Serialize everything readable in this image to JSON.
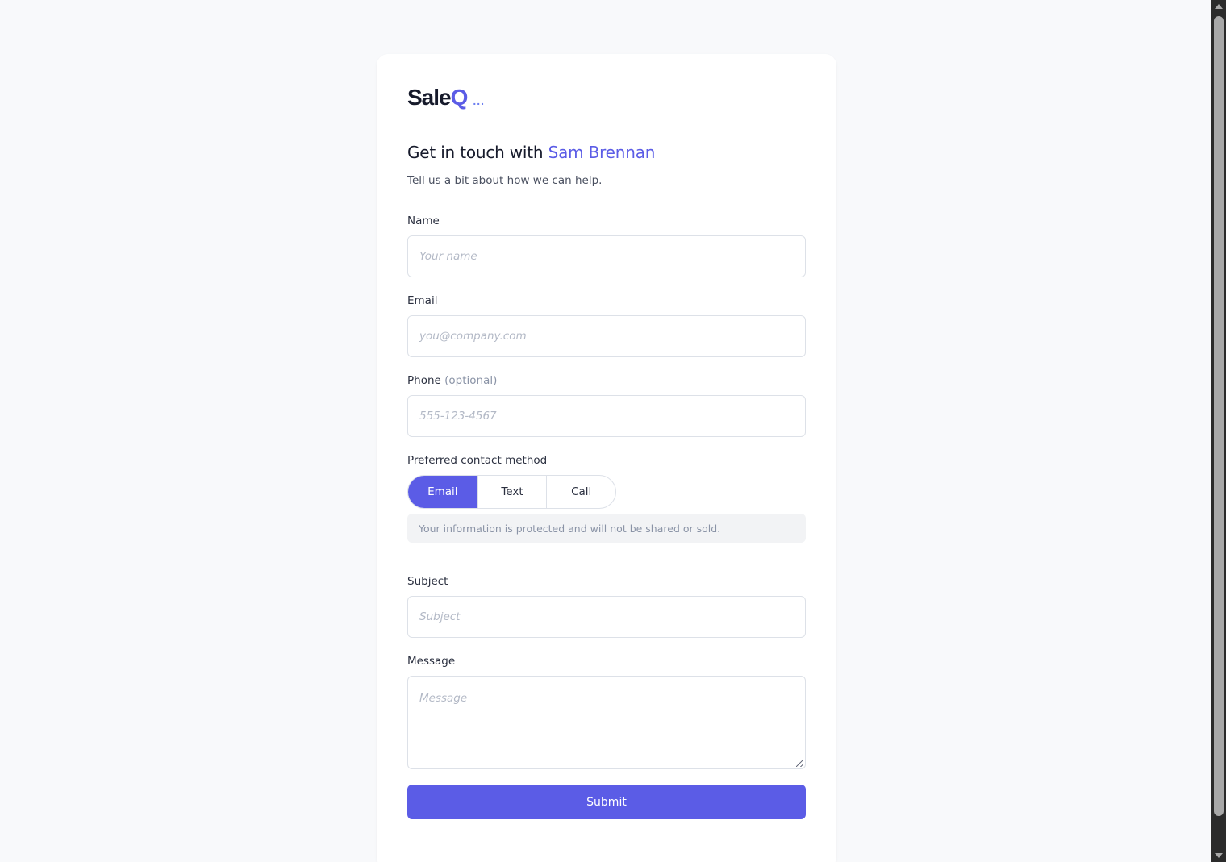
{
  "logo": {
    "main": "Sale",
    "accent": "Q",
    "dots": "..."
  },
  "heading": {
    "prefix": "Get in touch with ",
    "name": "Sam Brennan"
  },
  "subtitle": "Tell us a bit about how we can help.",
  "form": {
    "name": {
      "label": "Name",
      "placeholder": "Your name",
      "value": ""
    },
    "email": {
      "label": "Email",
      "placeholder": "you@company.com",
      "value": ""
    },
    "phone": {
      "label": "Phone",
      "optional": "(optional)",
      "placeholder": "555-123-4567",
      "value": ""
    },
    "contact_method": {
      "label": "Preferred contact method",
      "options": [
        "Email",
        "Text",
        "Call"
      ],
      "selected": "Email"
    },
    "privacy_notice": "Your information is protected and will not be shared or sold.",
    "subject": {
      "label": "Subject",
      "placeholder": "Subject",
      "value": ""
    },
    "message": {
      "label": "Message",
      "placeholder": "Message",
      "value": ""
    },
    "submit_label": "Submit"
  },
  "colors": {
    "accent": "#5b5ce6",
    "background": "#f8f9fb",
    "card": "#ffffff",
    "border": "#dde1e8"
  }
}
